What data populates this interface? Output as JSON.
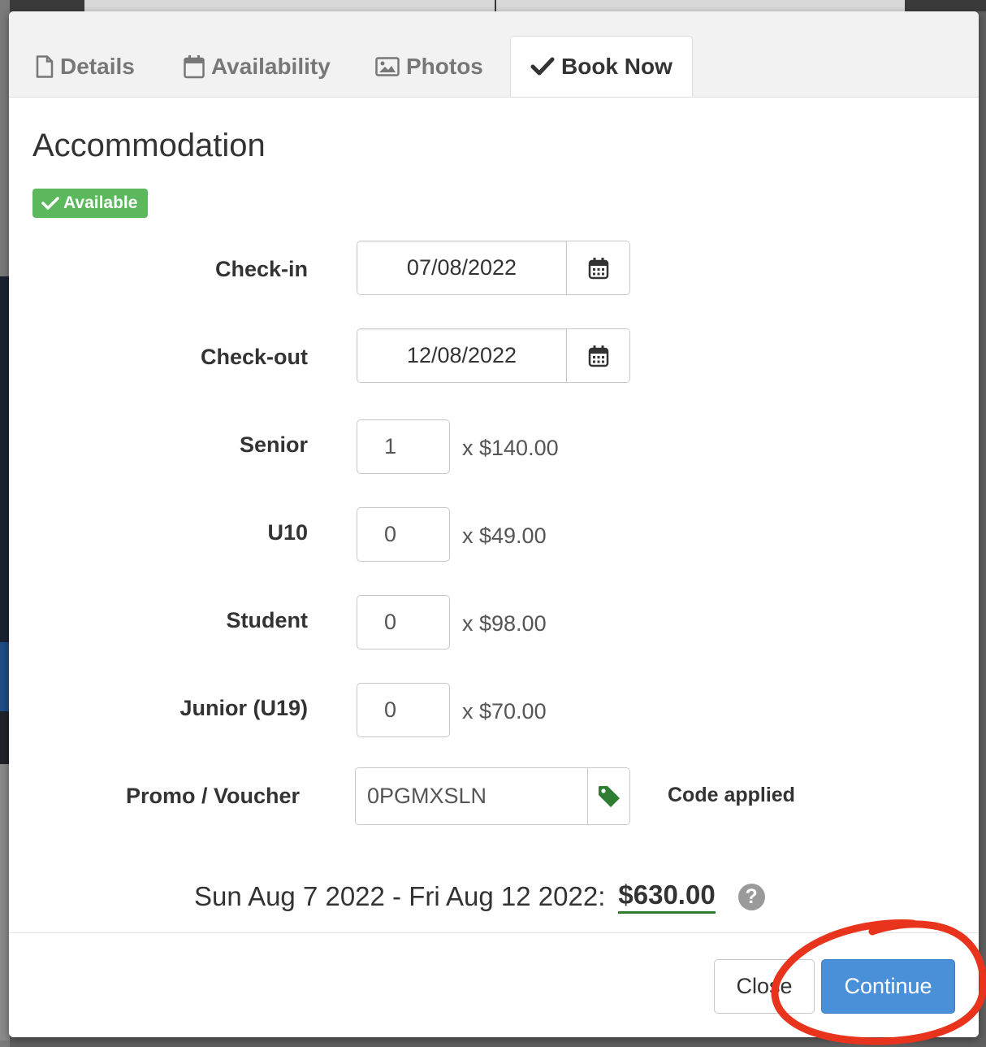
{
  "tabs": [
    {
      "label": "Details",
      "icon": "file-icon",
      "active": false
    },
    {
      "label": "Availability",
      "icon": "calendar-icon",
      "active": false
    },
    {
      "label": "Photos",
      "icon": "image-icon",
      "active": false
    },
    {
      "label": "Book Now",
      "icon": "check-icon",
      "active": true
    }
  ],
  "title": "Accommodation",
  "badge": "Available",
  "form": {
    "checkin": {
      "label": "Check-in",
      "value": "07/08/2022"
    },
    "checkout": {
      "label": "Check-out",
      "value": "12/08/2022"
    },
    "senior": {
      "label": "Senior",
      "value": "1",
      "price": "x $140.00"
    },
    "u10": {
      "label": "U10",
      "value": "0",
      "price": "x $49.00"
    },
    "student": {
      "label": "Student",
      "value": "0",
      "price": "x $98.00"
    },
    "junior": {
      "label": "Junior (U19)",
      "value": "0",
      "price": "x $70.00"
    },
    "promo": {
      "label": "Promo / Voucher",
      "value": "0PGMXSLN",
      "status": "Code applied",
      "icon": "tag-icon"
    }
  },
  "summary": {
    "dates": "Sun Aug 7 2022 - Fri Aug 12 2022:",
    "total": "$630.00",
    "help": "?"
  },
  "footer": {
    "close_label": "Close",
    "continue_label": "Continue"
  },
  "colors": {
    "accent": "#4a90d9",
    "success": "#5cb85c",
    "tag": "#2e7d32",
    "annotation": "#e8341c"
  }
}
